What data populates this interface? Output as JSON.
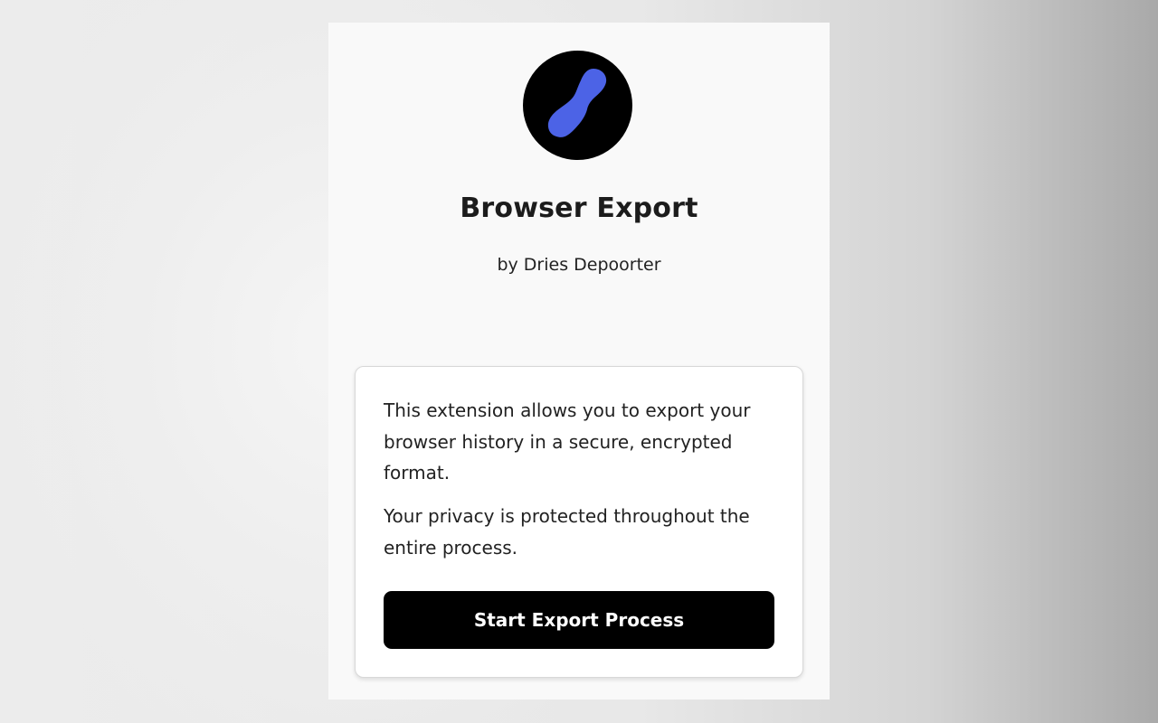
{
  "app": {
    "title": "Browser Export",
    "author": "by Dries Depoorter",
    "logo_icon": "link-capsule-icon",
    "logo_colors": {
      "background": "#000000",
      "shape": "#4c63e6"
    }
  },
  "card": {
    "description_1": "This extension allows you to export your browser history in a secure, encrypted format.",
    "description_2": "Your privacy is protected throughout the entire process.",
    "start_button_label": "Start Export Process"
  }
}
